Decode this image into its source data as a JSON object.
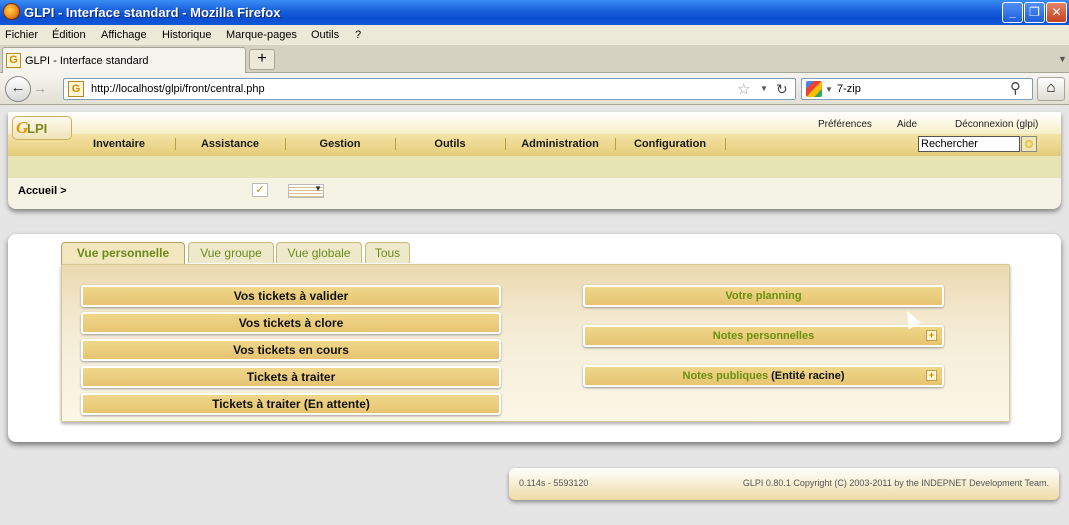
{
  "window": {
    "title": "GLPI - Interface standard - Mozilla Firefox",
    "min": "_",
    "max": "❐",
    "close": "✕"
  },
  "menubar": [
    "Fichier",
    "Édition",
    "Affichage",
    "Historique",
    "Marque-pages",
    "Outils",
    "?"
  ],
  "tab": {
    "label": "GLPI - Interface standard",
    "new": "+"
  },
  "nav": {
    "url": "http://localhost/glpi/front/central.php",
    "search": "7-zip"
  },
  "glpi": {
    "logo": "LPI",
    "logo_g": "G",
    "toplinks": [
      "Préférences",
      "Aide",
      "Déconnexion (glpi)"
    ],
    "menu": [
      "Inventaire",
      "Assistance",
      "Gestion",
      "Outils",
      "Administration",
      "Configuration"
    ],
    "search_value": "Rechercher",
    "breadcrumb": "Accueil >",
    "tabs": [
      "Vue personnelle",
      "Vue groupe",
      "Vue globale",
      "Tous"
    ],
    "left_buttons": [
      "Vos tickets à valider",
      "Vos tickets à clore",
      "Vos tickets en cours",
      "Tickets à traiter",
      "Tickets à traiter (En attente)"
    ],
    "planning": "Votre planning",
    "notes_perso": "Notes personnelles",
    "notes_pub": "Notes publiques",
    "notes_pub_entity": " (Entité racine)",
    "footer_left": "0.114s - 5593120",
    "footer_right": "GLPI 0.80.1 Copyright (C) 2003-2011 by the INDEPNET Development Team."
  }
}
